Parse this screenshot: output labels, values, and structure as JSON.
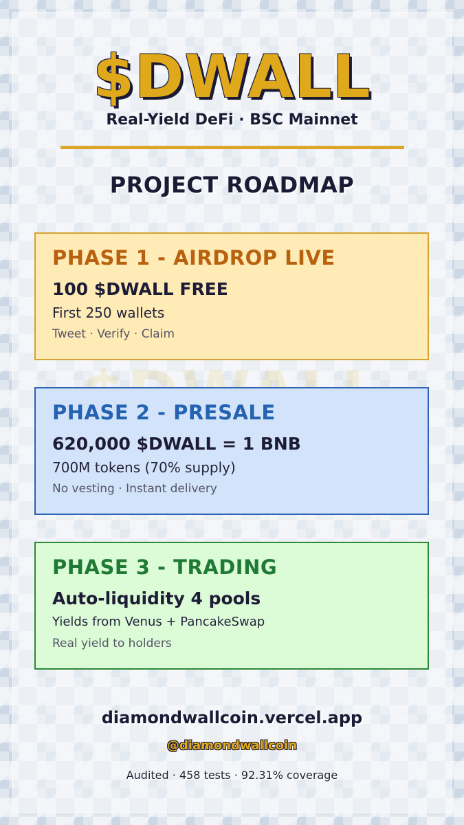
{
  "brand": {
    "name": "$DWALL",
    "tagline": "Real-Yield DeFi · BSC Mainnet"
  },
  "heading": "PROJECT ROADMAP",
  "phases": [
    {
      "title": "PHASE 1 - AIRDROP LIVE",
      "headline": "100 $DWALL FREE",
      "line1": "First 250 wallets",
      "line2": "Tweet · Verify · Claim",
      "accent": "#b8620f",
      "background": "#ffebb6",
      "border": "#d6a233"
    },
    {
      "title": "PHASE 2 - PRESALE",
      "headline": "620,000 $DWALL = 1 BNB",
      "line1": "700M tokens (70% supply)",
      "line2": "No vesting · Instant delivery",
      "accent": "#2463b2",
      "background": "#d3e4fa",
      "border": "#2c63b4"
    },
    {
      "title": "PHASE 3 - TRADING",
      "headline": "Auto-liquidity 4 pools",
      "line1": "Yields from Venus + PancakeSwap",
      "line2": "Real yield to holders",
      "accent": "#1f7a35",
      "background": "#dcfbd7",
      "border": "#2a8a38"
    }
  ],
  "footer": {
    "site": "diamondwallcoin.vercel.app",
    "handle": "@diamondwallcoin",
    "audit": "Audited · 458 tests · 92.31% coverage"
  },
  "colors": {
    "gold": "#e0a91c",
    "navy": "#1c1b36"
  }
}
